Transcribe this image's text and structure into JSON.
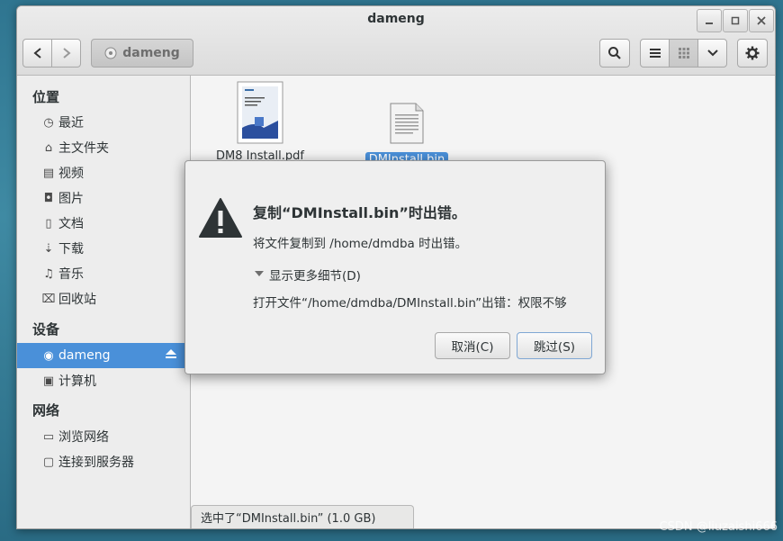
{
  "window": {
    "title": "dameng"
  },
  "toolbar": {
    "path_label": "dameng"
  },
  "sidebar": {
    "places_header": "位置",
    "places": [
      {
        "label": "最近"
      },
      {
        "label": "主文件夹"
      },
      {
        "label": "视频"
      },
      {
        "label": "图片"
      },
      {
        "label": "文档"
      },
      {
        "label": "下载"
      },
      {
        "label": "音乐"
      },
      {
        "label": "回收站"
      }
    ],
    "devices_header": "设备",
    "devices": [
      {
        "label": "dameng"
      },
      {
        "label": "计算机"
      }
    ],
    "network_header": "网络",
    "network": [
      {
        "label": "浏览网络"
      },
      {
        "label": "连接到服务器"
      }
    ]
  },
  "files": [
    {
      "name": "DM8 Install.pdf"
    },
    {
      "name": "DMInstall.bin"
    }
  ],
  "statusbar": {
    "text": "选中了“DMInstall.bin” (1.0 GB)"
  },
  "dialog": {
    "title": "复制“DMInstall.bin”时出错。",
    "message": "将文件复制到 /home/dmdba 时出错。",
    "details_toggle": "显示更多细节(D)",
    "error_text": "打开文件“/home/dmdba/DMInstall.bin”出错：权限不够",
    "cancel_label": "取消(C)",
    "skip_label": "跳过(S)"
  },
  "watermark": "CSDN @liuzaishi666",
  "colors": {
    "selection": "#4a90d9",
    "desktop": "#2c6f86"
  }
}
